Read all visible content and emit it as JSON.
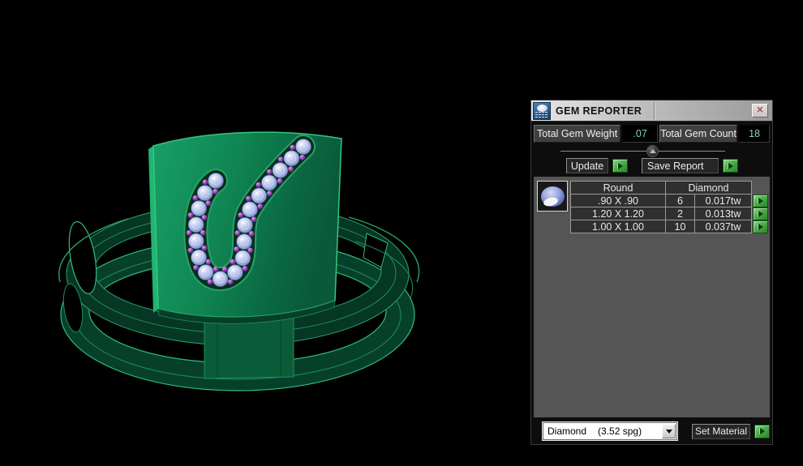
{
  "window": {
    "title": "GEM REPORTER",
    "close_glyph": "✕"
  },
  "totals": {
    "weight_label": "Total Gem Weight",
    "weight_value": ".07",
    "count_label": "Total Gem Count",
    "count_value": "18"
  },
  "actions": {
    "update_label": "Update",
    "save_report_label": "Save Report",
    "set_material_label": "Set Material"
  },
  "gem_table": {
    "shape_header": "Round",
    "material_header": "Diamond",
    "rows": [
      {
        "size": ".90 X .90",
        "count": "6",
        "weight": "0.017tw"
      },
      {
        "size": "1.20 X 1.20",
        "count": "2",
        "weight": "0.013tw"
      },
      {
        "size": "1.00 X 1.00",
        "count": "10",
        "weight": "0.037tw"
      }
    ]
  },
  "material_dropdown": {
    "value": "Diamond",
    "density": "(3.52 spg)"
  },
  "viewport": {
    "gem_count": 18,
    "colors": {
      "metal_dark": "#05331e",
      "metal_mid": "#0a5c38",
      "metal_light": "#17a567",
      "edge_bright": "#2fbd7a",
      "edge_dim": "#1d8f5a",
      "channel": "#06301d",
      "gem_light": "#eef1fb",
      "gem_mid": "#aebbe8",
      "gem_dark": "#6f7fc0",
      "bead_light": "#d9a8ec",
      "bead_mid": "#8f3cb4",
      "bead_dark": "#4d1468"
    }
  },
  "ui_colors": {
    "accent_green_button": "#4cb24c",
    "value_text_teal": "#84cfc2",
    "report_area_gray": "#555555",
    "titlebar_light": "#e8e8e8",
    "titlebar_dark": "#9a9a9a"
  }
}
